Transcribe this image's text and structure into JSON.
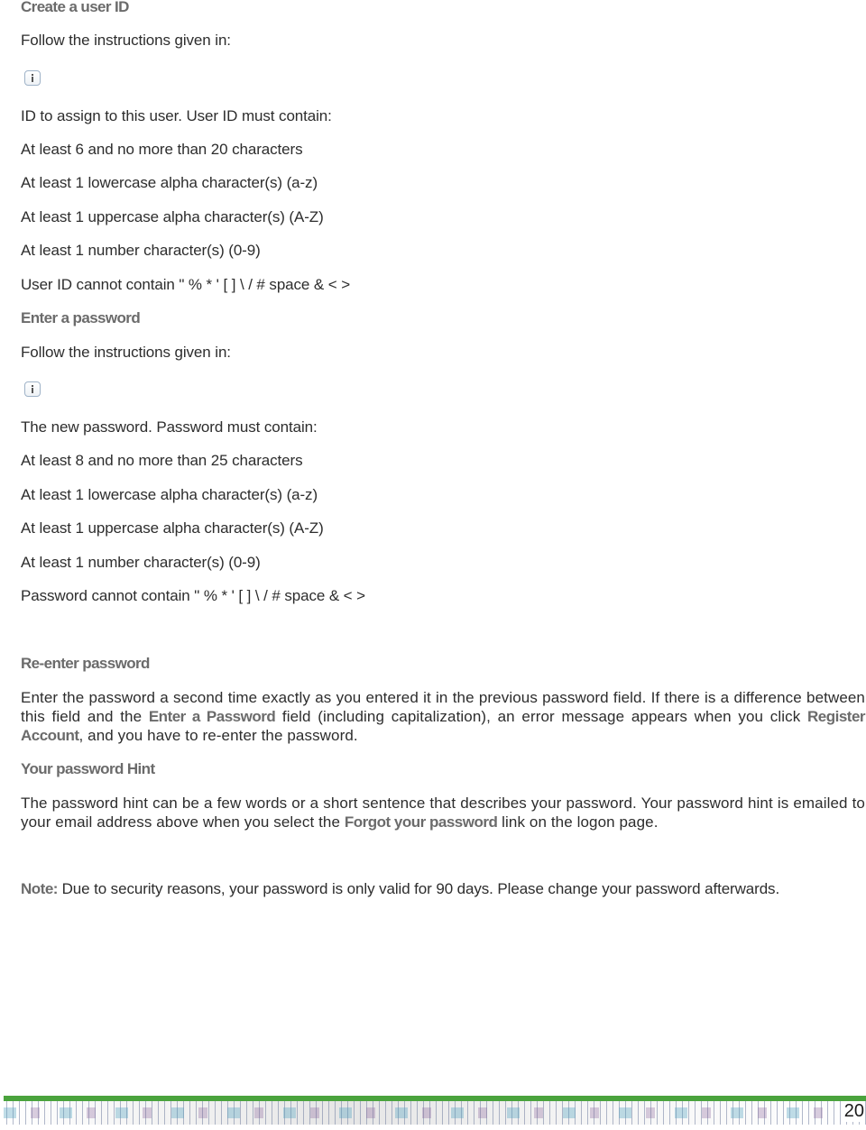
{
  "sections": {
    "user_id": {
      "heading": "Create a user ID",
      "follow": "Follow the instructions given in:",
      "info_icon": "info-icon",
      "intro": "ID to assign to this user. User ID must contain:",
      "rules": [
        "At least 6 and no more than 20 characters",
        "At least 1 lowercase alpha character(s) (a-z)",
        "At least 1 uppercase alpha character(s) (A-Z)",
        "At least 1 number character(s) (0-9)",
        "User ID cannot contain \" % * ' [ ] \\ / # space & < >"
      ]
    },
    "password": {
      "heading": "Enter a password",
      "follow": "Follow the instructions given in:",
      "info_icon": "info-icon",
      "intro": "The new password. Password must contain:",
      "rules": [
        "At least 8 and no more than 25 characters",
        "At least 1 lowercase alpha character(s) (a-z)",
        "At least 1 uppercase alpha character(s) (A-Z)",
        "At least 1 number character(s) (0-9)",
        "Password cannot contain \" % * ' [ ] \\ / # space & < >"
      ]
    },
    "reenter": {
      "heading": "Re-enter password",
      "text_1": "Enter the password a second time exactly as you entered it in the previous password field. If there is a difference between this field and the ",
      "term_1": "Enter a Password",
      "text_2": " field (including capitalization), an error message appears when you click ",
      "term_2": "Register Account",
      "text_3": ", and you have to re-enter the password."
    },
    "hint": {
      "heading": "Your password Hint",
      "text_1": "The password hint can be a few words or a short sentence that describes your password. Your password hint is emailed to your email address above when you select the ",
      "term_1": "Forgot your password",
      "text_2": " link on the logon page."
    },
    "note": {
      "label": "Note:",
      "text": " Due to security reasons, your password is only valid for 90 days. Please change your password afterwards."
    }
  },
  "footer": {
    "page_number": "20",
    "accent_color": "#4aa33d"
  }
}
